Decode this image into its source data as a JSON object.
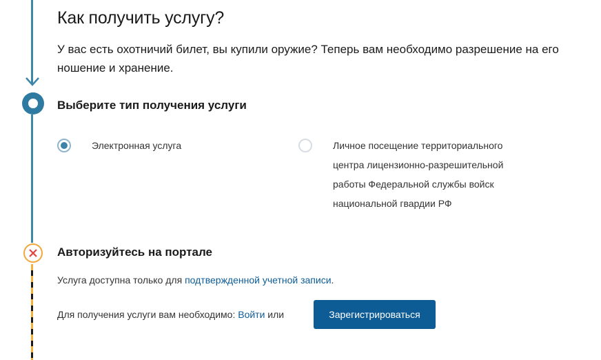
{
  "page": {
    "title": "Как получить услугу?",
    "intro": "У вас есть охотничий билет, вы купили оружие? Теперь вам необходимо разрешение на его ношение и хранение."
  },
  "step1": {
    "heading": "Выберите тип получения услуги",
    "options": [
      {
        "label": "Электронная услуга",
        "selected": true
      },
      {
        "label": "Личное посещение территориального центра лицензионно-разрешительной работы Федеральной службы войск национальной гвардии РФ",
        "selected": false
      }
    ]
  },
  "step2": {
    "heading": "Авторизуйтесь на портале",
    "availability_prefix": "Услуга доступна только для ",
    "availability_link": "подтвержденной учетной записи",
    "availability_suffix": ".",
    "need_prefix": "Для получения услуги вам необходимо: ",
    "login_link": "Войти",
    "or": " или",
    "register_button": "Зарегистрироваться"
  },
  "colors": {
    "accent": "#0d5c96",
    "timeline": "#3e86a8",
    "warning": "#f0a83c",
    "error_x": "#e0443c"
  },
  "icons": {
    "timeline_arrow": "arrow-down-icon",
    "step1_marker": "ring-icon",
    "step2_marker": "close-icon"
  }
}
